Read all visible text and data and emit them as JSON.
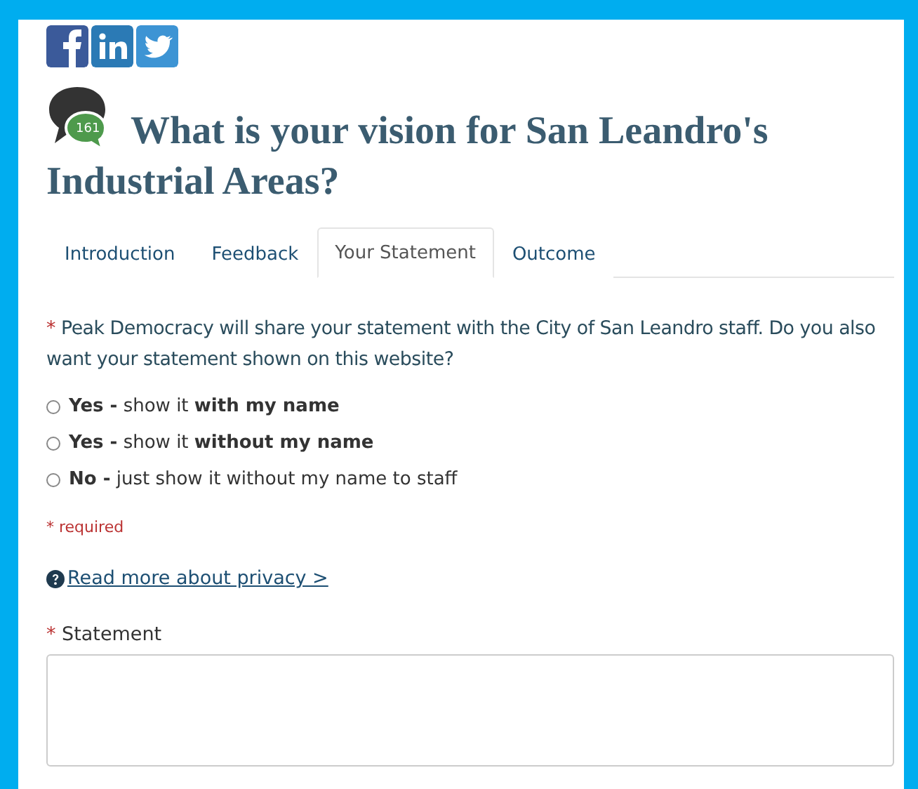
{
  "social_links": [
    {
      "kind": "facebook"
    },
    {
      "kind": "linkedin"
    },
    {
      "kind": "twitter"
    }
  ],
  "title": {
    "comment_count": "161",
    "lines": [
      "What is your vision for San Leandro's",
      "Industrial Areas?"
    ]
  },
  "tabs": [
    {
      "label": "Introduction",
      "selected": false
    },
    {
      "label": "Feedback",
      "selected": false
    },
    {
      "label": "Your Statement",
      "selected": true
    },
    {
      "label": "Outcome",
      "selected": false
    }
  ],
  "question": {
    "marker": "*",
    "text": "Peak Democracy will share your statement with the City of San Leandro staff. Do you also want your statement shown on this website?"
  },
  "options": [
    {
      "label": "**Yes -** show it **with my name**",
      "selected": false
    },
    {
      "label": "**Yes -** show it **without my name**",
      "selected": false
    },
    {
      "label": "**No -** just show it without my name to staff",
      "selected": false
    }
  ],
  "required_note": "* required",
  "privacy_link": "Read more about privacy >",
  "statement": {
    "marker": "*",
    "label": "Statement"
  }
}
